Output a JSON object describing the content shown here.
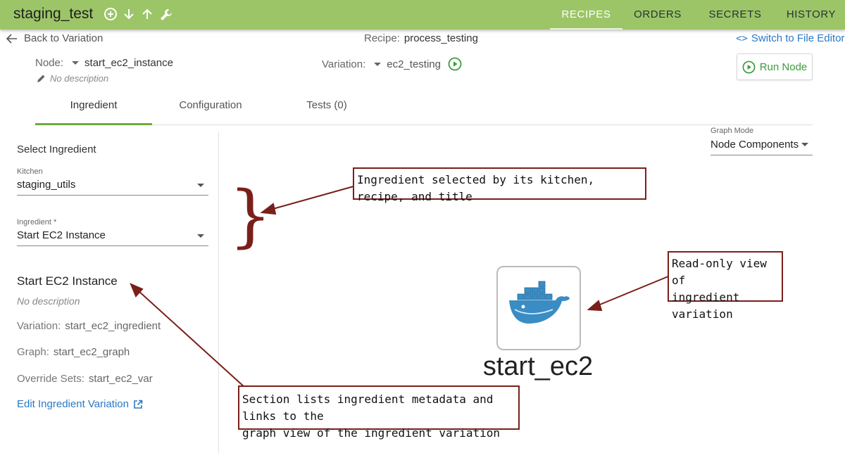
{
  "app": {
    "title": "staging_test",
    "toolbar_icons": [
      "add-circle-icon",
      "arrow-down-icon",
      "arrow-up-icon",
      "wrench-icon"
    ]
  },
  "nav": {
    "items": [
      "RECIPES",
      "ORDERS",
      "SECRETS",
      "HISTORY"
    ],
    "active": "RECIPES"
  },
  "header": {
    "back_label": "Back to Variation",
    "recipe_label": "Recipe:",
    "recipe_value": "process_testing",
    "switch_label": "Switch to File Editor",
    "node_label": "Node:",
    "node_value": "start_ec2_instance",
    "node_description": "No description",
    "variation_label": "Variation:",
    "variation_value": "ec2_testing",
    "run_label": "Run Node"
  },
  "tabs": [
    "Ingredient",
    "Configuration",
    "Tests (0)"
  ],
  "left_panel": {
    "title": "Select Ingredient",
    "kitchen_label": "Kitchen",
    "kitchen_value": "staging_utils",
    "ingredient_label": "Ingredient *",
    "ingredient_value": "Start EC2 Instance",
    "ingredient_title": "Start EC2 Instance",
    "ingredient_description": "No description",
    "variation_label": "Variation:",
    "variation_value": "start_ec2_ingredient",
    "graph_label": "Graph:",
    "graph_value": "start_ec2_graph",
    "override_label": "Override Sets:",
    "override_value": "start_ec2_var",
    "edit_link": "Edit Ingredient Variation"
  },
  "graph": {
    "mode_label": "Graph Mode",
    "mode_value": "Node Components",
    "node_label": "start_ec2",
    "node_icon": "docker-whale-icon"
  },
  "annotations": {
    "a1": "Ingredient selected by its kitchen, recipe, and title",
    "a2_line1": "Read-only view of",
    "a2_line2": "ingredient variation",
    "a3_line1": "Section lists ingredient metadata and links to the",
    "a3_line2": "graph view of the ingredient variation"
  },
  "colors": {
    "topbar": "#9cc567",
    "accent": "#6dab3c",
    "link": "#2a79c4",
    "annotation_border": "#7a1f1a",
    "docker_blue": "#3a8cc4"
  }
}
